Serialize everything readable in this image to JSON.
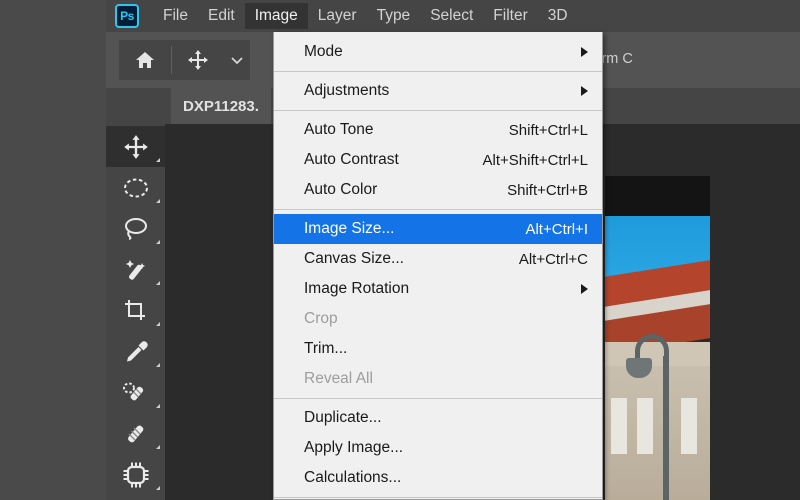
{
  "app": {
    "logo_text": "Ps",
    "accent_blue": "#1473E6",
    "logo_cyan": "#31C5F0"
  },
  "menubar": {
    "items": [
      {
        "label": "File",
        "active": false
      },
      {
        "label": "Edit",
        "active": false
      },
      {
        "label": "Image",
        "active": true
      },
      {
        "label": "Layer",
        "active": false
      },
      {
        "label": "Type",
        "active": false
      },
      {
        "label": "Select",
        "active": false
      },
      {
        "label": "Filter",
        "active": false
      },
      {
        "label": "3D",
        "active": false
      }
    ]
  },
  "options_bar": {
    "home_icon": "home-icon",
    "tool_icon": "move-tool-icon",
    "chevron_icon": "chevron-down-icon",
    "transform_label": "ansform C"
  },
  "document_tab": {
    "title": "DXP11283."
  },
  "tools": {
    "collapse_icon": "double-chevron-right-icon",
    "items": [
      {
        "name": "move-tool",
        "selected": true
      },
      {
        "name": "elliptical-marquee-tool",
        "selected": false
      },
      {
        "name": "lasso-tool",
        "selected": false
      },
      {
        "name": "magic-wand-tool",
        "selected": false
      },
      {
        "name": "crop-tool",
        "selected": false
      },
      {
        "name": "eyedropper-tool",
        "selected": false
      },
      {
        "name": "spot-healing-brush-tool",
        "selected": false
      },
      {
        "name": "brush-tool",
        "selected": false
      },
      {
        "name": "clone-stamp-tool",
        "selected": false
      }
    ]
  },
  "image_menu": {
    "rows": [
      {
        "kind": "item",
        "label": "Mode",
        "accel": "",
        "submenu": true,
        "disabled": false,
        "highlight": false
      },
      {
        "kind": "separator"
      },
      {
        "kind": "item",
        "label": "Adjustments",
        "accel": "",
        "submenu": true,
        "disabled": false,
        "highlight": false
      },
      {
        "kind": "separator"
      },
      {
        "kind": "item",
        "label": "Auto Tone",
        "accel": "Shift+Ctrl+L",
        "submenu": false,
        "disabled": false,
        "highlight": false
      },
      {
        "kind": "item",
        "label": "Auto Contrast",
        "accel": "Alt+Shift+Ctrl+L",
        "submenu": false,
        "disabled": false,
        "highlight": false
      },
      {
        "kind": "item",
        "label": "Auto Color",
        "accel": "Shift+Ctrl+B",
        "submenu": false,
        "disabled": false,
        "highlight": false
      },
      {
        "kind": "separator"
      },
      {
        "kind": "item",
        "label": "Image Size...",
        "accel": "Alt+Ctrl+I",
        "submenu": false,
        "disabled": false,
        "highlight": true
      },
      {
        "kind": "item",
        "label": "Canvas Size...",
        "accel": "Alt+Ctrl+C",
        "submenu": false,
        "disabled": false,
        "highlight": false
      },
      {
        "kind": "item",
        "label": "Image Rotation",
        "accel": "",
        "submenu": true,
        "disabled": false,
        "highlight": false
      },
      {
        "kind": "item",
        "label": "Crop",
        "accel": "",
        "submenu": false,
        "disabled": true,
        "highlight": false
      },
      {
        "kind": "item",
        "label": "Trim...",
        "accel": "",
        "submenu": false,
        "disabled": false,
        "highlight": false
      },
      {
        "kind": "item",
        "label": "Reveal All",
        "accel": "",
        "submenu": false,
        "disabled": true,
        "highlight": false
      },
      {
        "kind": "separator"
      },
      {
        "kind": "item",
        "label": "Duplicate...",
        "accel": "",
        "submenu": false,
        "disabled": false,
        "highlight": false
      },
      {
        "kind": "item",
        "label": "Apply Image...",
        "accel": "",
        "submenu": false,
        "disabled": false,
        "highlight": false
      },
      {
        "kind": "item",
        "label": "Calculations...",
        "accel": "",
        "submenu": false,
        "disabled": false,
        "highlight": false
      },
      {
        "kind": "separator"
      }
    ]
  },
  "canvas": {
    "photo_description": "building-photo"
  }
}
